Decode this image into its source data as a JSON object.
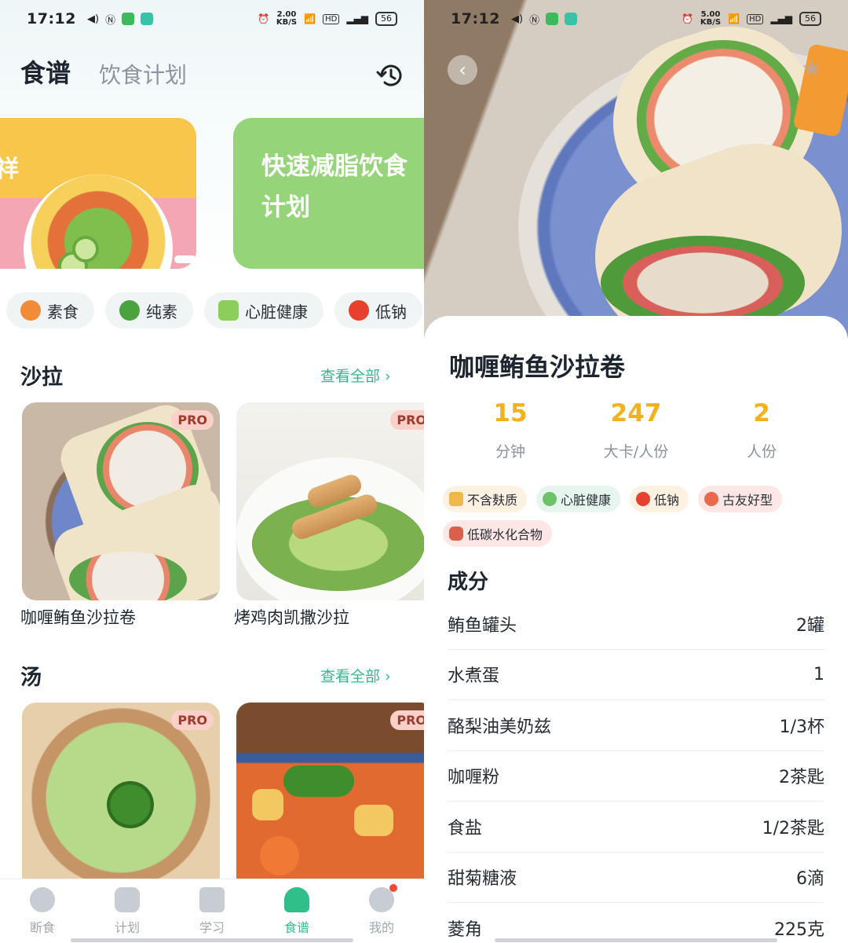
{
  "left": {
    "status": {
      "time": "17:12",
      "speed": "2.00\nKB/S",
      "battery": "56"
    },
    "tabs": {
      "active": "食谱",
      "inactive": "饮食计划"
    },
    "banner2_text": "快速减脂饮食计划",
    "banner1_char": "祥",
    "chips": [
      {
        "label": "素食",
        "icon": "carrot-icon",
        "color": "#f28c38"
      },
      {
        "label": "纯素",
        "icon": "broccoli-icon",
        "color": "#4aa33f"
      },
      {
        "label": "心脏健康",
        "icon": "bowl-icon",
        "color": "#8bcf5a"
      },
      {
        "label": "低钠",
        "icon": "tomato-icon",
        "color": "#e8402f"
      }
    ],
    "sections": [
      {
        "title": "沙拉",
        "see_all": "查看全部 ›",
        "cards": [
          {
            "name": "咖喱鲔鱼沙拉卷",
            "badge": "PRO"
          },
          {
            "name": "烤鸡肉凯撒沙拉",
            "badge": "PRO"
          }
        ]
      },
      {
        "title": "汤",
        "see_all": "查看全部 ›",
        "cards": [
          {
            "name": "",
            "badge": "PRO"
          },
          {
            "name": "",
            "badge": "PRO"
          }
        ]
      }
    ],
    "nav": [
      {
        "label": "断食",
        "icon": "stopwatch-icon"
      },
      {
        "label": "计划",
        "icon": "book-icon"
      },
      {
        "label": "学习",
        "icon": "notebook-icon"
      },
      {
        "label": "食谱",
        "icon": "chef-hat-icon"
      },
      {
        "label": "我的",
        "icon": "profile-icon"
      }
    ],
    "accent": "#2fbf8a"
  },
  "right": {
    "status": {
      "time": "17:12",
      "speed": "5.00\nKB/S",
      "battery": "56"
    },
    "title": "咖喱鲔鱼沙拉卷",
    "stats": [
      {
        "value": "15",
        "label": "分钟"
      },
      {
        "value": "247",
        "label": "大卡/人份"
      },
      {
        "value": "2",
        "label": "人份"
      }
    ],
    "tags": [
      {
        "label": "不含麸质",
        "bg": "#fdf1e2",
        "icon_color": "#f0b84a"
      },
      {
        "label": "心脏健康",
        "bg": "#e6f6ee",
        "icon_color": "#6cc36a"
      },
      {
        "label": "低钠",
        "bg": "#fdf1e2",
        "icon_color": "#e8402f"
      },
      {
        "label": "古友好型",
        "bg": "#fde7e6",
        "icon_color": "#e9694f"
      },
      {
        "label": "低碳水化合物",
        "bg": "#fde7e6",
        "icon_color": "#d9604a"
      }
    ],
    "ingredients_title": "成分",
    "ingredients": [
      {
        "name": "鲔鱼罐头",
        "qty": "2罐"
      },
      {
        "name": "水煮蛋",
        "qty": "1"
      },
      {
        "name": "酪梨油美奶兹",
        "qty": "1/3杯"
      },
      {
        "name": "咖喱粉",
        "qty": "2茶匙"
      },
      {
        "name": "食盐",
        "qty": "1/2茶匙"
      },
      {
        "name": "甜菊糖液",
        "qty": "6滴"
      },
      {
        "name": "菱角",
        "qty": "225克"
      }
    ],
    "accent": "#f3b21d"
  }
}
